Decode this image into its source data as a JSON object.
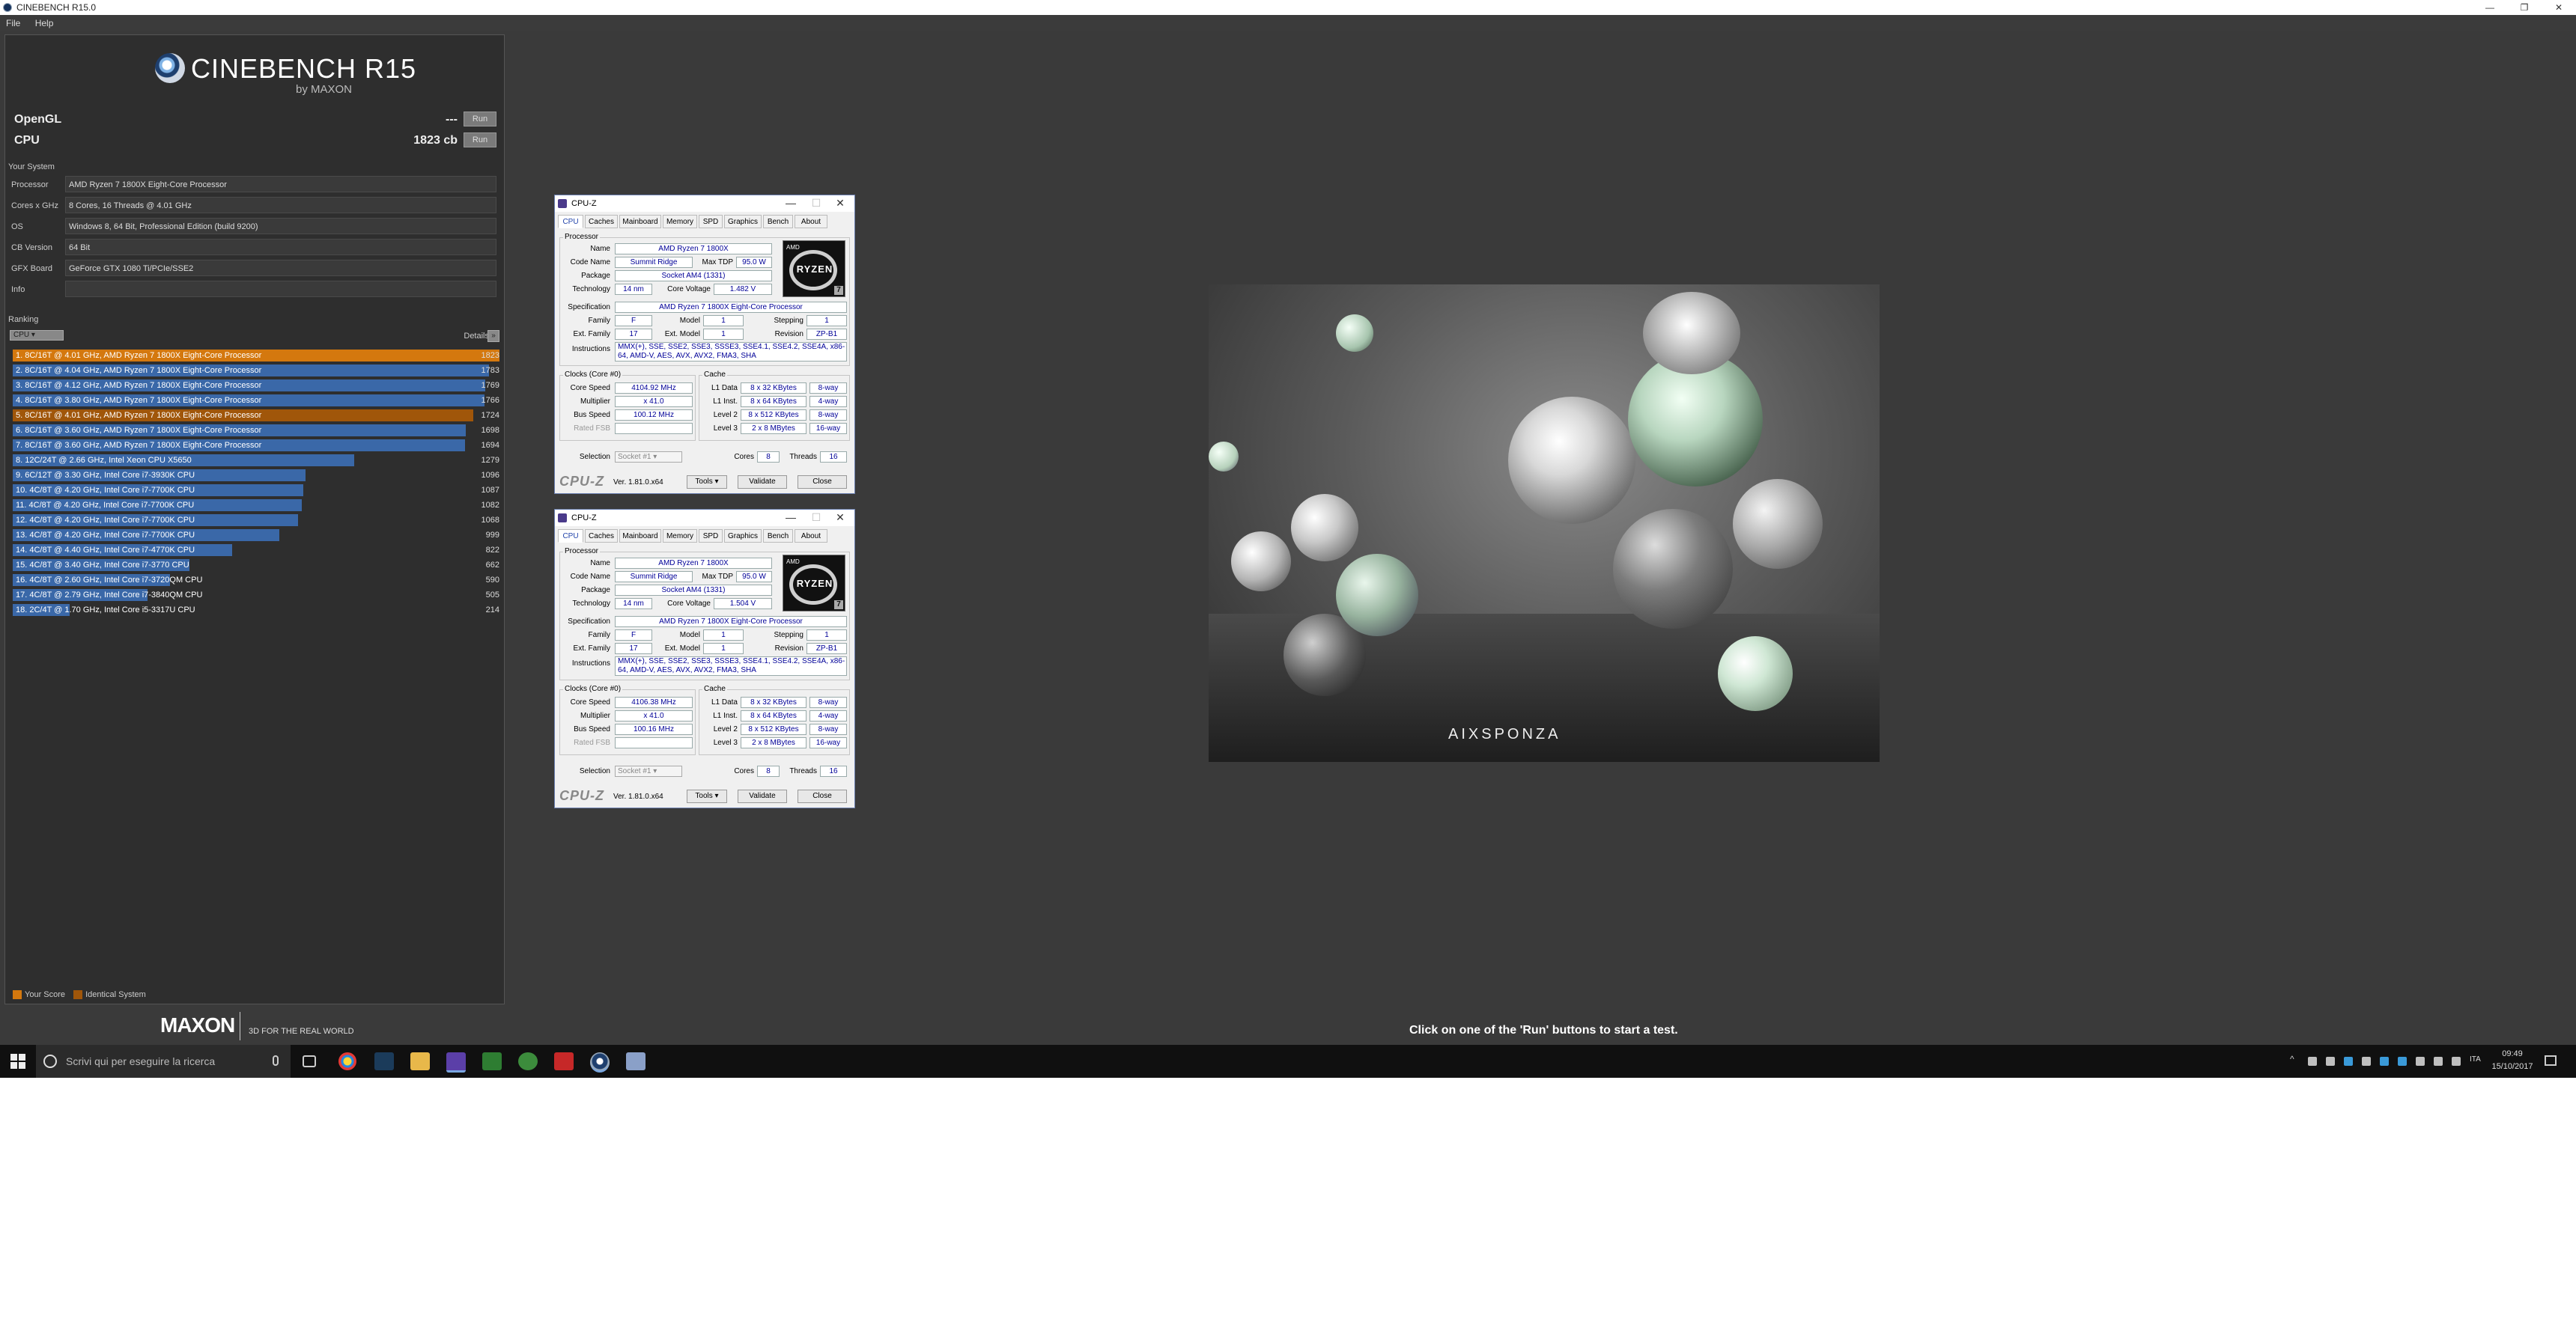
{
  "window": {
    "title": "CINEBENCH R15.0"
  },
  "menu": [
    "File",
    "Help"
  ],
  "logo": {
    "name": "CINEBENCH R15",
    "by": "by MAXON"
  },
  "tests": {
    "opengl": {
      "label": "OpenGL",
      "score": "---",
      "run": "Run"
    },
    "cpu": {
      "label": "CPU",
      "score": "1823 cb",
      "run": "Run"
    }
  },
  "system": {
    "title": "Your System",
    "rows": [
      {
        "label": "Processor",
        "value": "AMD Ryzen 7 1800X Eight-Core Processor"
      },
      {
        "label": "Cores x GHz",
        "value": "8 Cores, 16 Threads @ 4.01 GHz"
      },
      {
        "label": "OS",
        "value": "Windows 8, 64 Bit, Professional Edition (build 9200)"
      },
      {
        "label": "CB Version",
        "value": "64 Bit"
      },
      {
        "label": "GFX Board",
        "value": "GeForce GTX 1080 Ti/PCIe/SSE2"
      },
      {
        "label": "Info",
        "value": ""
      }
    ]
  },
  "ranking": {
    "title": "Ranking",
    "filter": "CPU",
    "details": "Details",
    "details_btn": "»",
    "max": 1823,
    "rows": [
      {
        "label": "1. 8C/16T @ 4.01 GHz, AMD Ryzen 7 1800X Eight-Core Processor",
        "value": 1823,
        "kind": "orange"
      },
      {
        "label": "2. 8C/16T @ 4.04 GHz, AMD Ryzen 7 1800X Eight-Core Processor",
        "value": 1783,
        "kind": "blue"
      },
      {
        "label": "3. 8C/16T @ 4.12 GHz, AMD Ryzen 7 1800X Eight-Core Processor",
        "value": 1769,
        "kind": "blue"
      },
      {
        "label": "4. 8C/16T @ 3.80 GHz, AMD Ryzen 7 1800X Eight-Core Processor",
        "value": 1766,
        "kind": "blue"
      },
      {
        "label": "5. 8C/16T @ 4.01 GHz, AMD Ryzen 7 1800X Eight-Core Processor",
        "value": 1724,
        "kind": "brown"
      },
      {
        "label": "6. 8C/16T @ 3.60 GHz, AMD Ryzen 7 1800X Eight-Core Processor",
        "value": 1698,
        "kind": "blue"
      },
      {
        "label": "7. 8C/16T @ 3.60 GHz, AMD Ryzen 7 1800X Eight-Core Processor",
        "value": 1694,
        "kind": "blue"
      },
      {
        "label": "8. 12C/24T @ 2.66 GHz, Intel Xeon CPU X5650",
        "value": 1279,
        "kind": "blue"
      },
      {
        "label": "9. 6C/12T @ 3.30 GHz,  Intel Core i7-3930K CPU",
        "value": 1096,
        "kind": "blue"
      },
      {
        "label": "10. 4C/8T @ 4.20 GHz, Intel Core i7-7700K CPU",
        "value": 1087,
        "kind": "blue"
      },
      {
        "label": "11. 4C/8T @ 4.20 GHz, Intel Core i7-7700K CPU",
        "value": 1082,
        "kind": "blue"
      },
      {
        "label": "12. 4C/8T @ 4.20 GHz, Intel Core i7-7700K CPU",
        "value": 1068,
        "kind": "blue"
      },
      {
        "label": "13. 4C/8T @ 4.20 GHz, Intel Core i7-7700K CPU",
        "value": 999,
        "kind": "blue"
      },
      {
        "label": "14. 4C/8T @ 4.40 GHz, Intel Core i7-4770K CPU",
        "value": 822,
        "kind": "blue"
      },
      {
        "label": "15. 4C/8T @ 3.40 GHz,  Intel Core i7-3770 CPU",
        "value": 662,
        "kind": "blue"
      },
      {
        "label": "16. 4C/8T @ 2.60 GHz, Intel Core i7-3720QM CPU",
        "value": 590,
        "kind": "blue"
      },
      {
        "label": "17. 4C/8T @ 2.79 GHz,  Intel Core i7-3840QM CPU",
        "value": 505,
        "kind": "blue"
      },
      {
        "label": "18. 2C/4T @ 1.70 GHz,  Intel Core i5-3317U CPU",
        "value": 214,
        "kind": "blue"
      }
    ]
  },
  "legend": {
    "your_score": "Your Score",
    "identical": "Identical System"
  },
  "footer": {
    "maxon": "MAXON",
    "tagline": "3D FOR THE REAL WORLD",
    "status": "Click on one of the 'Run' buttons to start a test."
  },
  "cpuz_windows": [
    {
      "title": "CPU-Z",
      "tabs": [
        "CPU",
        "Caches",
        "Mainboard",
        "Memory",
        "SPD",
        "Graphics",
        "Bench",
        "About"
      ],
      "processor_title": "Processor",
      "name": "AMD Ryzen 7 1800X",
      "code_name": "Summit Ridge",
      "max_tdp": "95.0 W",
      "package": "Socket AM4 (1331)",
      "technology": "14 nm",
      "core_voltage": "1.482 V",
      "specification": "AMD Ryzen 7 1800X Eight-Core Processor",
      "family": "F",
      "model": "1",
      "stepping": "1",
      "ext_family": "17",
      "ext_model": "1",
      "revision": "ZP-B1",
      "instructions": "MMX(+), SSE, SSE2, SSE3, SSSE3, SSE4.1, SSE4.2, SSE4A, x86-64, AMD-V, AES, AVX, AVX2, FMA3, SHA",
      "clocks_title": "Clocks (Core #0)",
      "core_speed": "4104.92 MHz",
      "multiplier": "x 41.0",
      "bus_speed": "100.12 MHz",
      "rated_fsb": "",
      "cache_title": "Cache",
      "l1_data": "8 x 32 KBytes",
      "l1_data_way": "8-way",
      "l1_inst": "8 x 64 KBytes",
      "l1_inst_way": "4-way",
      "level2": "8 x 512 KBytes",
      "level2_way": "8-way",
      "level3": "2 x 8 MBytes",
      "level3_way": "16-way",
      "selection": "Socket #1",
      "cores": "8",
      "threads": "16",
      "version": "Ver. 1.81.0.x64",
      "tools": "Tools",
      "validate": "Validate",
      "close": "Close"
    },
    {
      "title": "CPU-Z",
      "tabs": [
        "CPU",
        "Caches",
        "Mainboard",
        "Memory",
        "SPD",
        "Graphics",
        "Bench",
        "About"
      ],
      "processor_title": "Processor",
      "name": "AMD Ryzen 7 1800X",
      "code_name": "Summit Ridge",
      "max_tdp": "95.0 W",
      "package": "Socket AM4 (1331)",
      "technology": "14 nm",
      "core_voltage": "1.504 V",
      "specification": "AMD Ryzen 7 1800X Eight-Core Processor",
      "family": "F",
      "model": "1",
      "stepping": "1",
      "ext_family": "17",
      "ext_model": "1",
      "revision": "ZP-B1",
      "instructions": "MMX(+), SSE, SSE2, SSE3, SSSE3, SSE4.1, SSE4.2, SSE4A, x86-64, AMD-V, AES, AVX, AVX2, FMA3, SHA",
      "clocks_title": "Clocks (Core #0)",
      "core_speed": "4106.38 MHz",
      "multiplier": "x 41.0",
      "bus_speed": "100.16 MHz",
      "rated_fsb": "",
      "cache_title": "Cache",
      "l1_data": "8 x 32 KBytes",
      "l1_data_way": "8-way",
      "l1_inst": "8 x 64 KBytes",
      "l1_inst_way": "4-way",
      "level2": "8 x 512 KBytes",
      "level2_way": "8-way",
      "level3": "2 x 8 MBytes",
      "level3_way": "16-way",
      "selection": "Socket #1",
      "cores": "8",
      "threads": "16",
      "version": "Ver. 1.81.0.x64",
      "tools": "Tools",
      "validate": "Validate",
      "close": "Close"
    }
  ],
  "cpuz_labels": {
    "name": "Name",
    "code_name": "Code Name",
    "max_tdp": "Max TDP",
    "package": "Package",
    "technology": "Technology",
    "core_voltage": "Core Voltage",
    "specification": "Specification",
    "family": "Family",
    "model": "Model",
    "stepping": "Stepping",
    "ext_family": "Ext. Family",
    "ext_model": "Ext. Model",
    "revision": "Revision",
    "instructions": "Instructions",
    "core_speed": "Core Speed",
    "multiplier": "Multiplier",
    "bus_speed": "Bus Speed",
    "rated_fsb": "Rated FSB",
    "l1_data": "L1 Data",
    "l1_inst": "L1 Inst.",
    "level2": "Level 2",
    "level3": "Level 3",
    "selection": "Selection",
    "cores": "Cores",
    "threads": "Threads",
    "brand": "CPU-Z"
  },
  "ryzen_logo": {
    "amd": "AMD",
    "word": "RYZEN",
    "tier": "7"
  },
  "render": {
    "brand": "AIXSPONZA"
  },
  "taskbar": {
    "search_placeholder": "Scrivi qui per eseguire la ricerca",
    "time": "09:49",
    "date": "15/10/2017"
  },
  "colors": {
    "your_score": "#d4780e",
    "identical": "#a0560a",
    "bar": "#3a68a8"
  }
}
